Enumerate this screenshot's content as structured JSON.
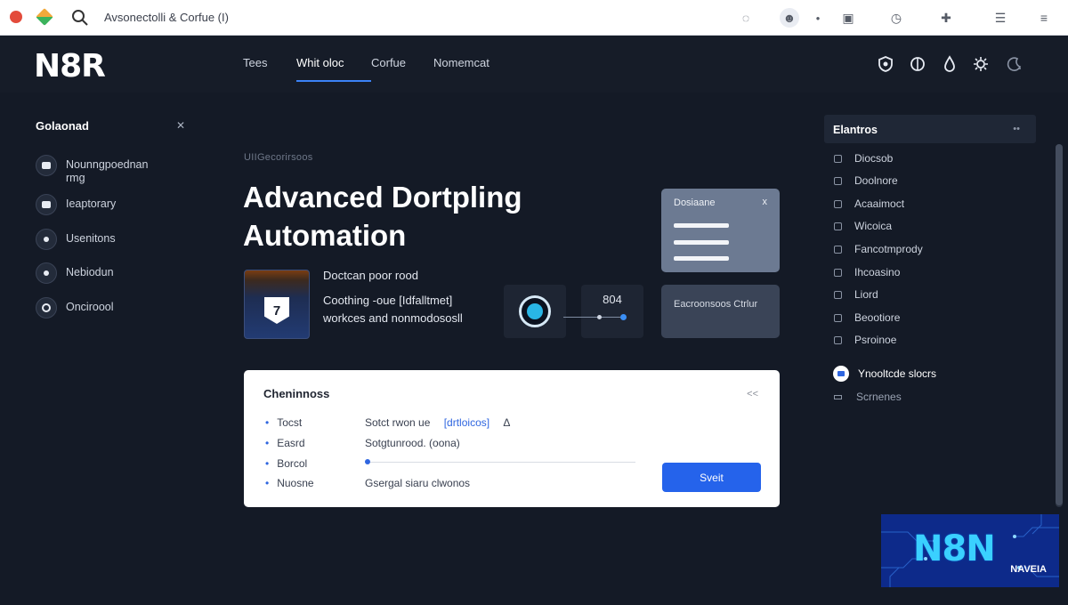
{
  "browser": {
    "title": "Avsonectolli & Corfue (I)"
  },
  "app": {
    "logo": "N8R",
    "nav": [
      {
        "label": "Tees",
        "active": false
      },
      {
        "label": "Whit oloc",
        "active": true
      },
      {
        "label": "Corfue",
        "active": false
      },
      {
        "label": "Nomemcat",
        "active": false
      }
    ],
    "header_icons": [
      "shield-icon",
      "globe-icon",
      "drop-icon",
      "gear-icon",
      "moon-icon"
    ]
  },
  "sidebar": {
    "title": "Golaonad",
    "items": [
      {
        "label": "Nounngpoednan rmg",
        "icon": "folder-icon"
      },
      {
        "label": "Ieaptorary",
        "icon": "library-icon"
      },
      {
        "label": "Usenitons",
        "icon": "user-icon"
      },
      {
        "label": "Nebiodun",
        "icon": "node-icon"
      },
      {
        "label": "Onciroool",
        "icon": "control-icon"
      }
    ]
  },
  "hero": {
    "kicker": "UIIGecorirsoos",
    "headline": "Advanced Dortpling Automation"
  },
  "feature": {
    "badge": "7",
    "title": "Doctcan poor rood",
    "description": "Coothing -oue [Idfalltmet] workces and nonmodososll"
  },
  "nodes": {
    "counter": "804"
  },
  "cards": {
    "top_title": "Dosiaane",
    "top_close": "x",
    "bottom_text": "Eacroonsoos Ctrlur"
  },
  "panel": {
    "title": "Cheninnoss",
    "close": "<<",
    "rows": [
      {
        "label": "Tocst",
        "value": "Sotct rwon ue",
        "link": "[drtloicos]",
        "suffix": "Δ"
      },
      {
        "label": "Easrd",
        "value": "Sotgtunrood. (oona)"
      },
      {
        "label": "Borcol",
        "value": ""
      },
      {
        "label": "Nuosne",
        "value": "Gsergal siaru clwonos"
      }
    ],
    "button": "Sveit"
  },
  "right_panel": {
    "title": "Elantros",
    "items": [
      "Diocsob",
      "Doolnore",
      "Acaaimoct",
      "Wicoica",
      "Fancotmprody",
      "Ihcoasino",
      "Liord",
      "Beootiore",
      "Psroinoe"
    ],
    "highlighted": "Ynooltcde slocrs",
    "sub": "Scrnenes"
  },
  "watermark": {
    "text": "N8N",
    "sub": "NAVEIA"
  }
}
